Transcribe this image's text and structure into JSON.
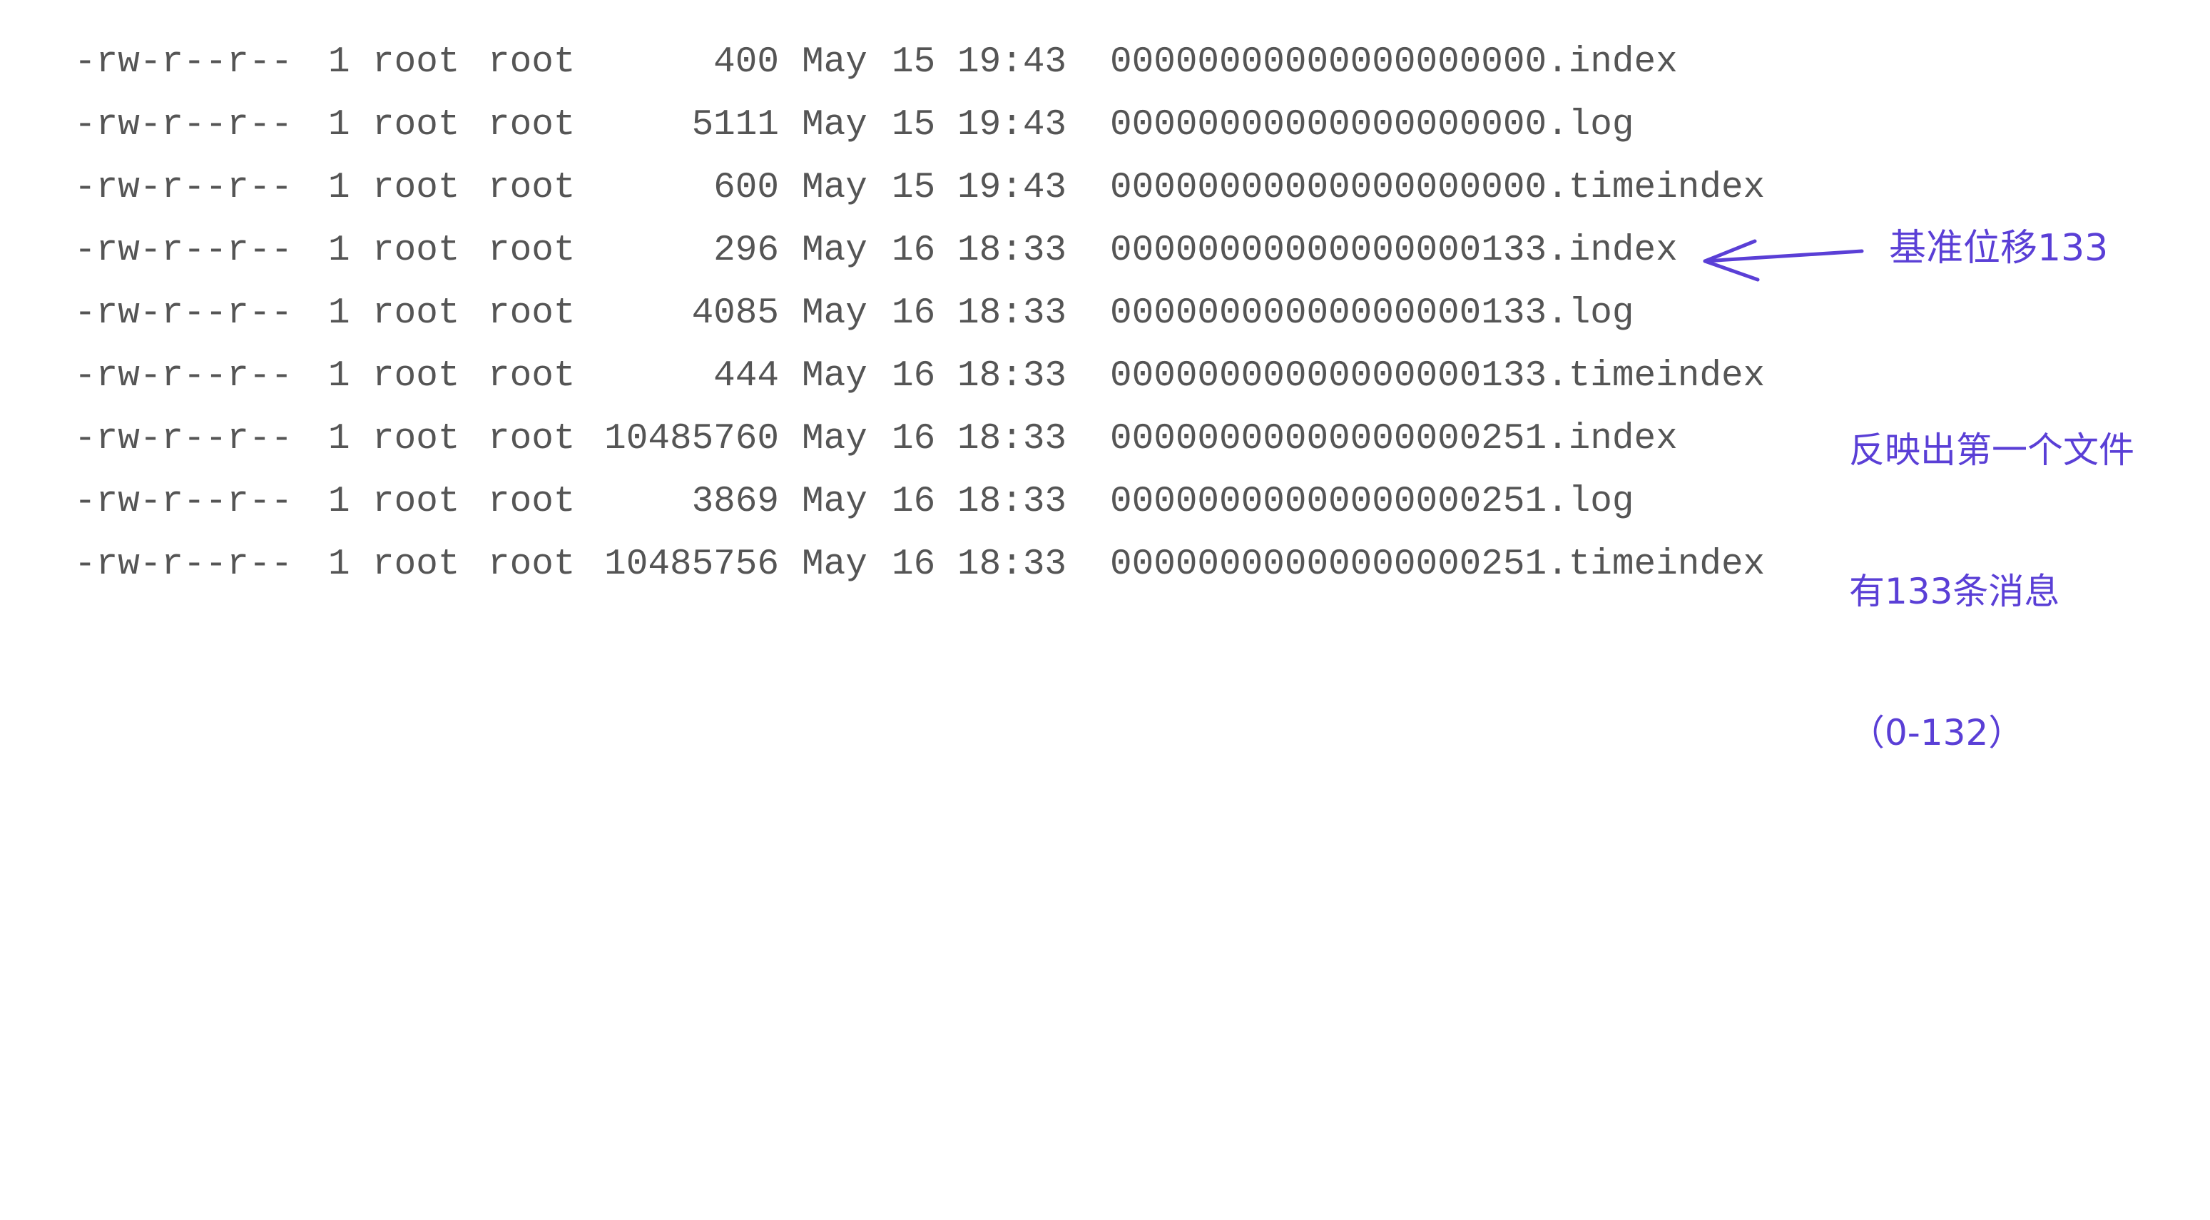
{
  "listing": {
    "rows": [
      {
        "perms": "-rw-r--r--",
        "links": "1",
        "owner": "root",
        "group": "root",
        "size": "400",
        "month": "May",
        "day": "15",
        "time": "19:43",
        "name": "00000000000000000000.index"
      },
      {
        "perms": "-rw-r--r--",
        "links": "1",
        "owner": "root",
        "group": "root",
        "size": "5111",
        "month": "May",
        "day": "15",
        "time": "19:43",
        "name": "00000000000000000000.log"
      },
      {
        "perms": "-rw-r--r--",
        "links": "1",
        "owner": "root",
        "group": "root",
        "size": "600",
        "month": "May",
        "day": "15",
        "time": "19:43",
        "name": "00000000000000000000.timeindex"
      },
      {
        "perms": "-rw-r--r--",
        "links": "1",
        "owner": "root",
        "group": "root",
        "size": "296",
        "month": "May",
        "day": "16",
        "time": "18:33",
        "name": "00000000000000000133.index"
      },
      {
        "perms": "-rw-r--r--",
        "links": "1",
        "owner": "root",
        "group": "root",
        "size": "4085",
        "month": "May",
        "day": "16",
        "time": "18:33",
        "name": "00000000000000000133.log"
      },
      {
        "perms": "-rw-r--r--",
        "links": "1",
        "owner": "root",
        "group": "root",
        "size": "444",
        "month": "May",
        "day": "16",
        "time": "18:33",
        "name": "00000000000000000133.timeindex"
      },
      {
        "perms": "-rw-r--r--",
        "links": "1",
        "owner": "root",
        "group": "root",
        "size": "10485760",
        "month": "May",
        "day": "16",
        "time": "18:33",
        "name": "00000000000000000251.index"
      },
      {
        "perms": "-rw-r--r--",
        "links": "1",
        "owner": "root",
        "group": "root",
        "size": "3869",
        "month": "May",
        "day": "16",
        "time": "18:33",
        "name": "00000000000000000251.log"
      },
      {
        "perms": "-rw-r--r--",
        "links": "1",
        "owner": "root",
        "group": "root",
        "size": "10485756",
        "month": "May",
        "day": "16",
        "time": "18:33",
        "name": "00000000000000000251.timeindex"
      }
    ]
  },
  "annotations": {
    "base_offset": "基准位移133",
    "note_lines": [
      "反映出第一个文件",
      "有133条消息",
      "（0-132）"
    ],
    "color": "#5a3fd6",
    "arrow_icon": "arrow-left-icon"
  }
}
